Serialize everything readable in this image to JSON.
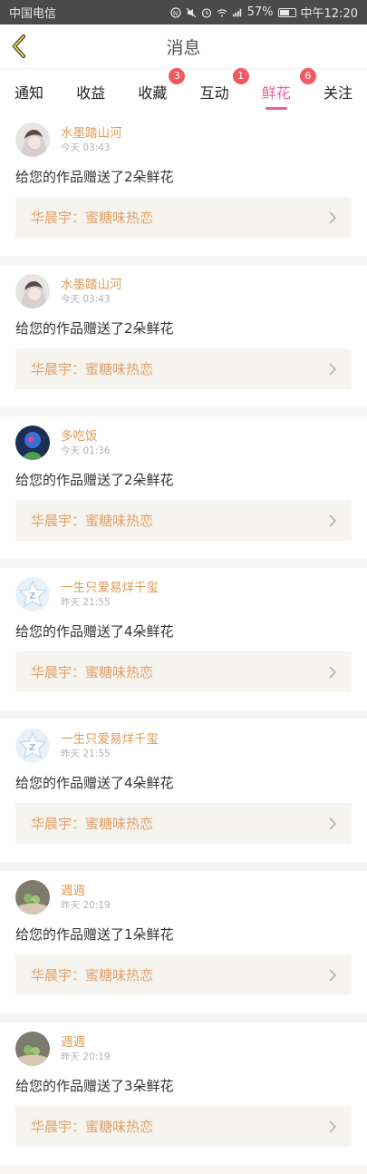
{
  "status": {
    "carrier": "中国电信",
    "battery": "57%",
    "time": "中午12:20"
  },
  "header": {
    "title": "消息"
  },
  "tabs": [
    {
      "label": "通知"
    },
    {
      "label": "收益"
    },
    {
      "label": "收藏",
      "badge": "3"
    },
    {
      "label": "互动",
      "badge": "1"
    },
    {
      "label": "鲜花",
      "badge": "6",
      "active": true
    },
    {
      "label": "关注"
    }
  ],
  "messages": [
    {
      "user": "水墨踏山河",
      "time": "今天 03:43",
      "text": "给您的作品赠送了2朵鲜花",
      "work": "华晨宇：蜜糖味热恋",
      "avatar": "anime-avatar"
    },
    {
      "user": "水墨踏山河",
      "time": "今天 03:43",
      "text": "给您的作品赠送了2朵鲜花",
      "work": "华晨宇：蜜糖味热恋",
      "avatar": "anime-avatar"
    },
    {
      "user": "多吃饭",
      "time": "今天 01:36",
      "text": "给您的作品赠送了2朵鲜花",
      "work": "华晨宇：蜜糖味热恋",
      "avatar": "dark-avatar"
    },
    {
      "user": "一生只爱易烊千玺",
      "time": "昨天 21:55",
      "text": "给您的作品赠送了4朵鲜花",
      "work": "华晨宇：蜜糖味热恋",
      "avatar": "default-star-avatar"
    },
    {
      "user": "一生只爱易烊千玺",
      "time": "昨天 21:55",
      "text": "给您的作品赠送了4朵鲜花",
      "work": "华晨宇：蜜糖味热恋",
      "avatar": "default-star-avatar"
    },
    {
      "user": "週週",
      "time": "昨天 20:19",
      "text": "给您的作品赠送了1朵鲜花",
      "work": "华晨宇：蜜糖味热恋",
      "avatar": "photo-avatar"
    },
    {
      "user": "週週",
      "time": "昨天 20:19",
      "text": "给您的作品赠送了3朵鲜花",
      "work": "华晨宇：蜜糖味热恋",
      "avatar": "photo-avatar"
    }
  ],
  "colors": {
    "accent": "#e8629a",
    "badge": "#f25a61",
    "username": "#e29b56",
    "work_bg": "#f6f4ee"
  }
}
